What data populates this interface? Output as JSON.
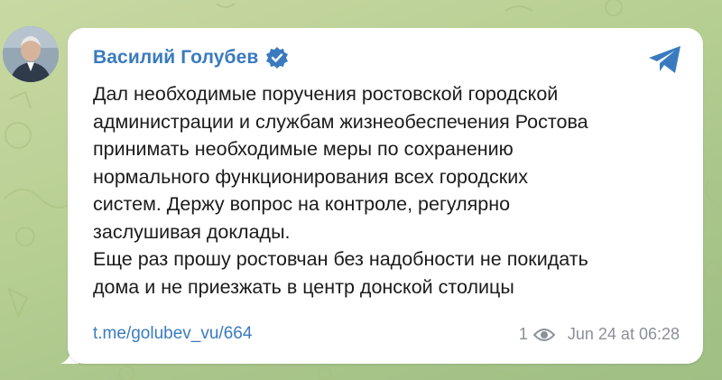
{
  "channel_post": {
    "author": "Василий Голубев",
    "verified_icon": "verified-badge-icon",
    "share_icon": "telegram-share-icon",
    "message_lines": "Дал необходимые поручения ростовской городской\nадминистрации и службам жизнеобеспечения Ростова\nпринимать необходимые меры по сохранению\nнормального функционирования всех городских\nсистем. Держу вопрос на контроле, регулярно\nзаслушивая доклады.\nЕще раз прошу ростовчан без надобности не покидать\nдома и не приезжать в центр донской столицы",
    "link": "t.me/golubev_vu/664",
    "views": "1",
    "timestamp": "Jun 24 at 06:28"
  },
  "colors": {
    "accent": "#3a7bbf",
    "background": "#b7cf93",
    "meta": "#8a9099"
  }
}
